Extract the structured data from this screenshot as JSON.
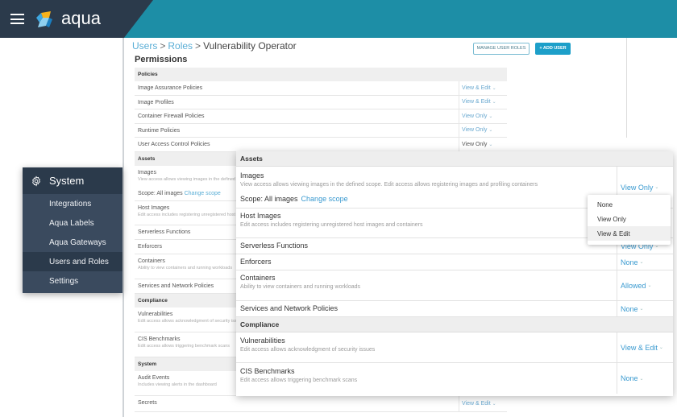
{
  "app": {
    "brand": "aqua"
  },
  "breadcrumb": {
    "users": "Users",
    "sep": ">",
    "roles": "Roles",
    "current": "Vulnerability Operator"
  },
  "page": {
    "title": "Permissions"
  },
  "actions": {
    "manage_roles": "MANAGE USER ROLES",
    "add_user": "+ ADD USER"
  },
  "colors": {
    "topbar_dark": "#2b3a4b",
    "topbar_accent": "#1d8ea6",
    "link": "#3a9ad0",
    "primary_button": "#1d9fc9"
  },
  "sidebar": {
    "section": "System",
    "items": [
      {
        "label": "Integrations",
        "active": false
      },
      {
        "label": "Aqua Labels",
        "active": false
      },
      {
        "label": "Aqua Gateways",
        "active": false
      },
      {
        "label": "Users and Roles",
        "active": true
      },
      {
        "label": "Settings",
        "active": false
      }
    ]
  },
  "back_table": {
    "policies": {
      "header": "Policies",
      "rows": [
        {
          "name": "Image Assurance Policies",
          "value": "View & Edit"
        },
        {
          "name": "Image Profiles",
          "value": "View & Edit"
        },
        {
          "name": "Container Firewall Policies",
          "value": "View Only"
        },
        {
          "name": "Runtime Policies",
          "value": "View Only"
        },
        {
          "name": "User Access Control Policies",
          "value": "View Only"
        }
      ]
    },
    "assets": {
      "header": "Assets",
      "rows": [
        {
          "name": "Images",
          "desc": "View access allows viewing images in the defined scope",
          "scope_label": "Scope: All images",
          "scope_link": "Change scope"
        },
        {
          "name": "Host Images",
          "desc": "Edit access includes registering unregistered host images"
        },
        {
          "name": "Serverless Functions"
        },
        {
          "name": "Enforcers"
        },
        {
          "name": "Containers",
          "desc": "Ability to view containers and running workloads"
        },
        {
          "name": "Services and Network Policies"
        }
      ]
    },
    "compliance": {
      "header": "Compliance",
      "rows": [
        {
          "name": "Vulnerabilities",
          "desc": "Edit access allows acknowledgment of security issues"
        },
        {
          "name": "CIS Benchmarks",
          "desc": "Edit access allows triggering benchmark scans"
        }
      ]
    },
    "system": {
      "header": "System",
      "rows": [
        {
          "name": "Audit Events",
          "desc": "Includes viewing alerts in the dashboard"
        },
        {
          "name": "Secrets",
          "value": "View & Edit"
        }
      ]
    }
  },
  "front_table": {
    "assets": {
      "header": "Assets",
      "rows": [
        {
          "name": "Images",
          "desc": "View access allows viewing images in the defined scope. Edit access allows registering images and profiling containers",
          "scope_label": "Scope: All images",
          "scope_link": "Change scope",
          "value": "View Only"
        },
        {
          "name": "Host Images",
          "desc": "Edit access includes registering unregistered host images and containers",
          "value": ""
        },
        {
          "name": "Serverless Functions",
          "value": "View Only"
        },
        {
          "name": "Enforcers",
          "value": "None"
        },
        {
          "name": "Containers",
          "desc": "Ability to view containers and running workloads",
          "value": "Allowed"
        },
        {
          "name": "Services and Network Policies",
          "value": "None"
        }
      ]
    },
    "compliance": {
      "header": "Compliance",
      "rows": [
        {
          "name": "Vulnerabilities",
          "desc": "Edit access allows acknowledgment of security issues",
          "value": "View & Edit"
        },
        {
          "name": "CIS Benchmarks",
          "desc": "Edit access allows triggering benchmark scans",
          "value": "None"
        }
      ]
    }
  },
  "dropdown": {
    "options": [
      "None",
      "View Only",
      "View & Edit"
    ],
    "highlighted": "View & Edit"
  }
}
